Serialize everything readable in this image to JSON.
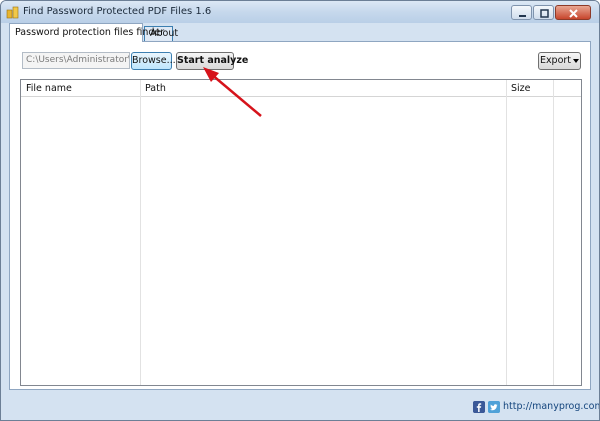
{
  "window": {
    "title": "Find Password Protected PDF Files 1.6",
    "buttons": [
      "minimize",
      "maximize",
      "close"
    ]
  },
  "tabs": [
    {
      "label": "Password protection files finder",
      "active": true
    },
    {
      "label": "About",
      "active": false
    }
  ],
  "toolbar": {
    "path_value": "C:\\Users\\Administrator\\De",
    "browse_label": "Browse...",
    "start_label": "Start analyze",
    "export_label": "Export"
  },
  "grid": {
    "columns": [
      "File name",
      "Path",
      "Size",
      ""
    ],
    "rows": []
  },
  "status": {
    "link_text": "http://manyprog.com",
    "icons": [
      "facebook-icon",
      "twitter-icon"
    ]
  },
  "annotation": {
    "arrow_color": "#d6131b"
  }
}
